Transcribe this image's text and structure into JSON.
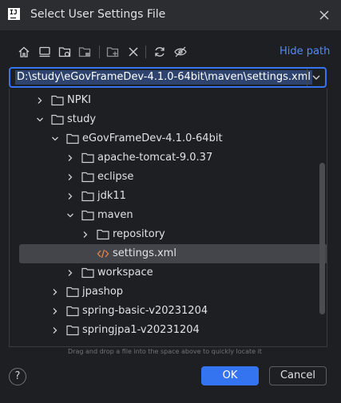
{
  "window": {
    "title": "Select User Settings File",
    "app_icon_text": "IJ"
  },
  "toolbar": {
    "icons": [
      "home-icon",
      "desktop-icon",
      "project-folder-icon",
      "module-folder-icon",
      "new-folder-icon",
      "delete-icon",
      "refresh-icon",
      "show-hidden-icon"
    ],
    "hide_path_label": "Hide path"
  },
  "path": {
    "value": "D:\\study\\eGovFrameDev-4.1.0-64bit\\maven\\settings.xml"
  },
  "tree": {
    "rows": [
      {
        "label": "NPKI",
        "depth": 0,
        "expanded": false,
        "type": "folder",
        "selected": false
      },
      {
        "label": "study",
        "depth": 0,
        "expanded": true,
        "type": "folder",
        "selected": false
      },
      {
        "label": "eGovFrameDev-4.1.0-64bit",
        "depth": 1,
        "expanded": true,
        "type": "folder",
        "selected": false
      },
      {
        "label": "apache-tomcat-9.0.37",
        "depth": 2,
        "expanded": false,
        "type": "folder",
        "selected": false
      },
      {
        "label": "eclipse",
        "depth": 2,
        "expanded": false,
        "type": "folder",
        "selected": false
      },
      {
        "label": "jdk11",
        "depth": 2,
        "expanded": false,
        "type": "folder",
        "selected": false
      },
      {
        "label": "maven",
        "depth": 2,
        "expanded": true,
        "type": "folder",
        "selected": false
      },
      {
        "label": "repository",
        "depth": 3,
        "expanded": false,
        "type": "folder",
        "selected": false
      },
      {
        "label": "settings.xml",
        "depth": 3,
        "expanded": null,
        "type": "xml-file",
        "selected": true
      },
      {
        "label": "workspace",
        "depth": 2,
        "expanded": false,
        "type": "folder",
        "selected": false
      },
      {
        "label": "jpashop",
        "depth": 1,
        "expanded": false,
        "type": "folder",
        "selected": false
      },
      {
        "label": "spring-basic-v20231204",
        "depth": 1,
        "expanded": false,
        "type": "folder",
        "selected": false
      },
      {
        "label": "springjpa1-v20231204",
        "depth": 1,
        "expanded": false,
        "type": "folder",
        "selected": false
      }
    ]
  },
  "hint": "Drag and drop a file into the space above to quickly locate it",
  "buttons": {
    "help": "?",
    "ok": "OK",
    "cancel": "Cancel"
  },
  "colors": {
    "accent": "#3574f0",
    "background": "#1e1f22",
    "selection": "#43454a",
    "link": "#548af7"
  }
}
